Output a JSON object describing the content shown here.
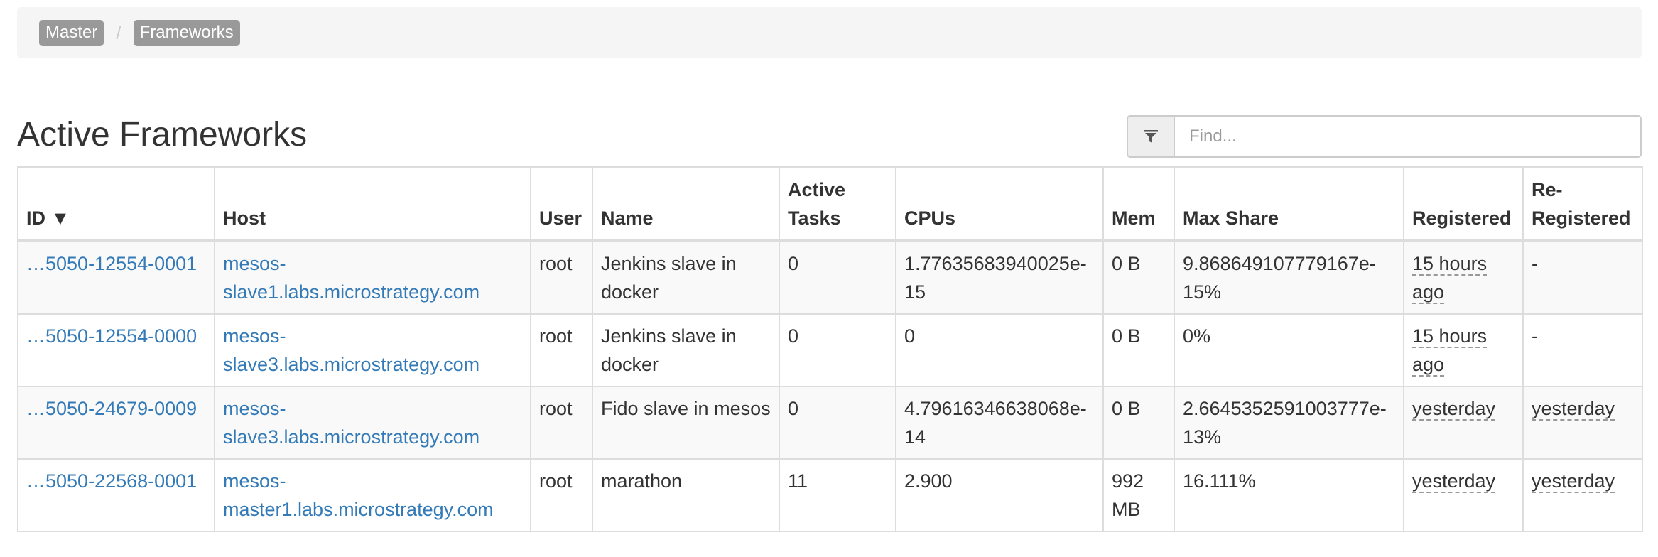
{
  "breadcrumb": {
    "items": [
      {
        "label": "Master"
      },
      {
        "label": "Frameworks"
      }
    ],
    "separator": "/"
  },
  "title": "Active Frameworks",
  "filter": {
    "icon": "filter-icon",
    "placeholder": "Find..."
  },
  "table": {
    "headers": {
      "id": "ID ▼",
      "host": "Host",
      "user": "User",
      "name": "Name",
      "active_tasks": "Active Tasks",
      "cpus": "CPUs",
      "mem": "Mem",
      "max_share": "Max Share",
      "registered": "Registered",
      "reregistered": "Re-Registered"
    },
    "rows": [
      {
        "id": "…5050-12554-0001",
        "host": "mesos-slave1.labs.microstrategy.com",
        "user": "root",
        "name": "Jenkins slave in docker",
        "active_tasks": "0",
        "cpus": "1.77635683940025e-15",
        "mem": "0 B",
        "max_share": "9.868649107779167e-15%",
        "registered": "15 hours ago",
        "reregistered": "-"
      },
      {
        "id": "…5050-12554-0000",
        "host": "mesos-slave3.labs.microstrategy.com",
        "user": "root",
        "name": "Jenkins slave in docker",
        "active_tasks": "0",
        "cpus": "0",
        "mem": "0 B",
        "max_share": "0%",
        "registered": "15 hours ago",
        "reregistered": "-"
      },
      {
        "id": "…5050-24679-0009",
        "host": "mesos-slave3.labs.microstrategy.com",
        "user": "root",
        "name": "Fido slave in mesos",
        "active_tasks": "0",
        "cpus": "4.79616346638068e-14",
        "mem": "0 B",
        "max_share": "2.6645352591003777e-13%",
        "registered": "yesterday",
        "reregistered": "yesterday"
      },
      {
        "id": "…5050-22568-0001",
        "host": "mesos-master1.labs.microstrategy.com",
        "user": "root",
        "name": "marathon",
        "active_tasks": "11",
        "cpus": "2.900",
        "mem": "992 MB",
        "max_share": "16.111%",
        "registered": "yesterday",
        "reregistered": "yesterday"
      }
    ]
  },
  "colors": {
    "link": "#337ab7",
    "crumb_bg": "#999999",
    "breadcrumb_bg": "#f5f5f5",
    "stripe": "#f9f9f9",
    "border": "#dddddd"
  }
}
